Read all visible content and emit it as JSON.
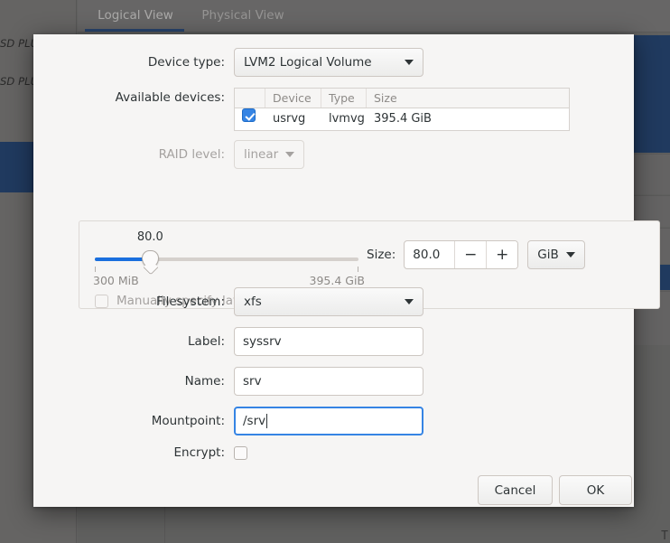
{
  "background": {
    "tabs": [
      {
        "label": "Logical View",
        "active": true
      },
      {
        "label": "Physical View",
        "active": false
      }
    ],
    "sidebar_entries": [
      {
        "label": "SD PLUS"
      },
      {
        "label": "SD PLUS"
      }
    ],
    "cursor_glyph": "T"
  },
  "dialog": {
    "device_type": {
      "label": "Device type:",
      "value": "LVM2 Logical Volume"
    },
    "available_devices": {
      "label": "Available devices:",
      "columns": [
        "",
        "Device",
        "Type",
        "Size"
      ],
      "rows": [
        {
          "checked": true,
          "device": "usrvg",
          "type": "lvmvg",
          "size": "395.4 GiB"
        }
      ]
    },
    "raid_level": {
      "label": "RAID level:",
      "value": "linear",
      "disabled": true
    },
    "size_section": {
      "slider_value_label": "80.0",
      "slider_min_label": "300 MiB",
      "slider_max_label": "395.4 GiB",
      "slider_fraction_percent": 21,
      "size_label": "Size:",
      "size_value": "80.0",
      "decrement_glyph": "−",
      "increment_glyph": "+",
      "unit": "GiB",
      "manual_layout_label": "Manually specify layout",
      "manual_layout_checked": false,
      "manual_layout_disabled": true
    },
    "filesystem": {
      "label": "Filesystem:",
      "value": "xfs"
    },
    "label_field": {
      "label": "Label:",
      "value": "syssrv"
    },
    "name_field": {
      "label": "Name:",
      "value": "srv"
    },
    "mountpoint_field": {
      "label": "Mountpoint:",
      "value": "/srv",
      "focused": true
    },
    "encrypt": {
      "label": "Encrypt:",
      "checked": false
    },
    "buttons": {
      "cancel": "Cancel",
      "ok": "OK"
    }
  },
  "colors": {
    "accent_blue": "#3584e4",
    "slider_blue": "#1a6fde",
    "selection_blue": "#1e4273",
    "dialog_bg": "#f6f5f4",
    "backdrop_grey": "#777776"
  }
}
